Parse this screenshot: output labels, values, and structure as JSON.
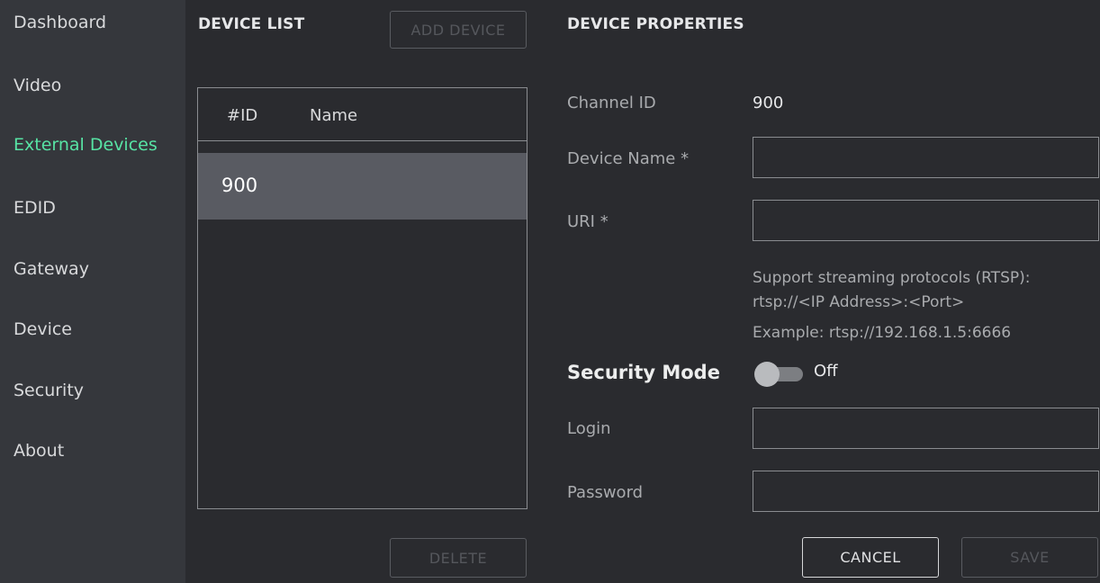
{
  "sidebar": {
    "items": [
      {
        "label": "Dashboard"
      },
      {
        "label": "Video"
      },
      {
        "label": "External Devices"
      },
      {
        "label": "EDID"
      },
      {
        "label": "Gateway"
      },
      {
        "label": "Device"
      },
      {
        "label": "Security"
      },
      {
        "label": "About"
      }
    ],
    "active": "External Devices",
    "active_color": "#57e3a4"
  },
  "device_list": {
    "title": "DEVICE LIST",
    "add_button": "ADD DEVICE",
    "delete_button": "DELETE",
    "columns": [
      "#ID",
      "Name"
    ],
    "rows": [
      {
        "id": "900",
        "name": ""
      }
    ]
  },
  "properties": {
    "title": "DEVICE PROPERTIES",
    "channel_id_label": "Channel ID",
    "channel_id_value": "900",
    "device_name_label": "Device Name *",
    "device_name_value": "",
    "uri_label": "URI *",
    "uri_value": "",
    "hint_lines": [
      "Support streaming protocols (RTSP):",
      "rtsp://<IP Address>:<Port>",
      "Example: rtsp://192.168.1.5:6666"
    ],
    "security_mode_label": "Security Mode",
    "security_mode_state": "Off",
    "login_label": "Login",
    "login_value": "",
    "password_label": "Password",
    "password_value": "",
    "cancel_button": "CANCEL",
    "save_button": "SAVE"
  }
}
